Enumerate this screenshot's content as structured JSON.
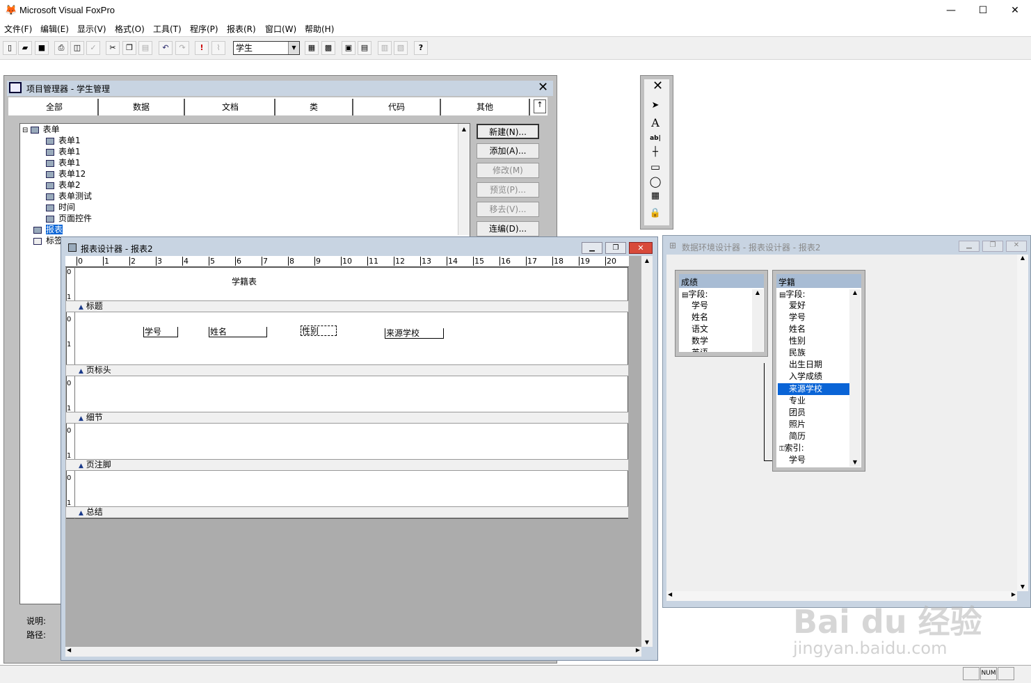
{
  "app": {
    "title": "Microsoft Visual FoxPro"
  },
  "menu": [
    "文件(F)",
    "编辑(E)",
    "显示(V)",
    "格式(O)",
    "工具(T)",
    "程序(P)",
    "报表(R)",
    "窗口(W)",
    "帮助(H)"
  ],
  "toolbar": {
    "combo_value": "学生"
  },
  "project": {
    "title": "项目管理器 - 学生管理",
    "tabs": [
      "全部",
      "数据",
      "文档",
      "类",
      "代码",
      "其他"
    ],
    "tree": {
      "root": "表单",
      "items": [
        "表单1",
        "表单1",
        "表单1",
        "表单12",
        "表单2",
        "表单测试",
        "时间",
        "页面控件"
      ],
      "report": "报表",
      "label": "标签"
    },
    "buttons": {
      "new": "新建(N)...",
      "add": "添加(A)...",
      "modify": "修改(M)",
      "preview": "预览(P)...",
      "remove": "移去(V)...",
      "build": "连编(D)..."
    },
    "desc_label": "说明:",
    "path_label": "路径:"
  },
  "report": {
    "title": "报表设计器 - 报表2",
    "ruler": [
      "0",
      "1",
      "2",
      "3",
      "4",
      "5",
      "6",
      "7",
      "8",
      "9",
      "10",
      "11",
      "12",
      "13",
      "14",
      "15",
      "16",
      "17",
      "18",
      "19",
      "20"
    ],
    "heading": "学籍表",
    "bands": [
      "标题",
      "页标头",
      "细节",
      "页注脚",
      "总结"
    ],
    "fields": [
      "学号",
      "姓名",
      "性别",
      "来源学校"
    ]
  },
  "dataenv": {
    "title": "数据环境设计器 - 报表设计器 - 报表2",
    "table1": {
      "name": "成绩",
      "fields_label": "字段:",
      "items": [
        "学号",
        "姓名",
        "语文",
        "数学",
        "英语"
      ]
    },
    "table2": {
      "name": "学籍",
      "fields_label": "字段:",
      "items": [
        "爱好",
        "学号",
        "姓名",
        "性别",
        "民族",
        "出生日期",
        "入学成绩",
        "来源学校",
        "专业",
        "团员",
        "照片",
        "简历"
      ],
      "index_label": "索引:",
      "index_items": [
        "学号"
      ],
      "selected": "来源学校"
    }
  },
  "status": {
    "num": "NUM"
  },
  "watermark": {
    "brand": "Bai du 经验",
    "url": "jingyan.baidu.com"
  }
}
